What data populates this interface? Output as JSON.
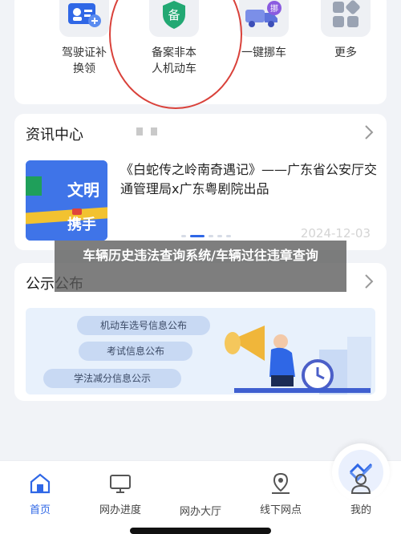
{
  "services": [
    {
      "label": "驾驶证补\n换领",
      "icon": "license-reissue-icon"
    },
    {
      "label": "备案非本\n人机动车",
      "icon": "shield-record-icon",
      "badge": "备"
    },
    {
      "label": "一键挪车",
      "icon": "move-car-icon",
      "badge": "挪"
    },
    {
      "label": "更多",
      "icon": "more-grid-icon"
    }
  ],
  "news": {
    "title": "资讯中心",
    "headline": "《白蛇传之岭南奇遇记》——广东省公安厅交通管理局x广东粤剧院出品",
    "date": "2024-12-03",
    "thumb_text_1": "文明",
    "thumb_text_2": "携手"
  },
  "notices": {
    "title": "公示公布",
    "items": [
      "机动车选号信息公布",
      "考试信息公布",
      "学法减分信息公示"
    ]
  },
  "caption": "车辆历史违法查询系统/车辆过往违章查询",
  "nav": {
    "items": [
      "首页",
      "网办进度",
      "网办大厅",
      "线下网点",
      "我的"
    ]
  },
  "colors": {
    "accent": "#2f67e6",
    "highlight_ring": "#d9413a",
    "badge_green": "#22a873"
  }
}
